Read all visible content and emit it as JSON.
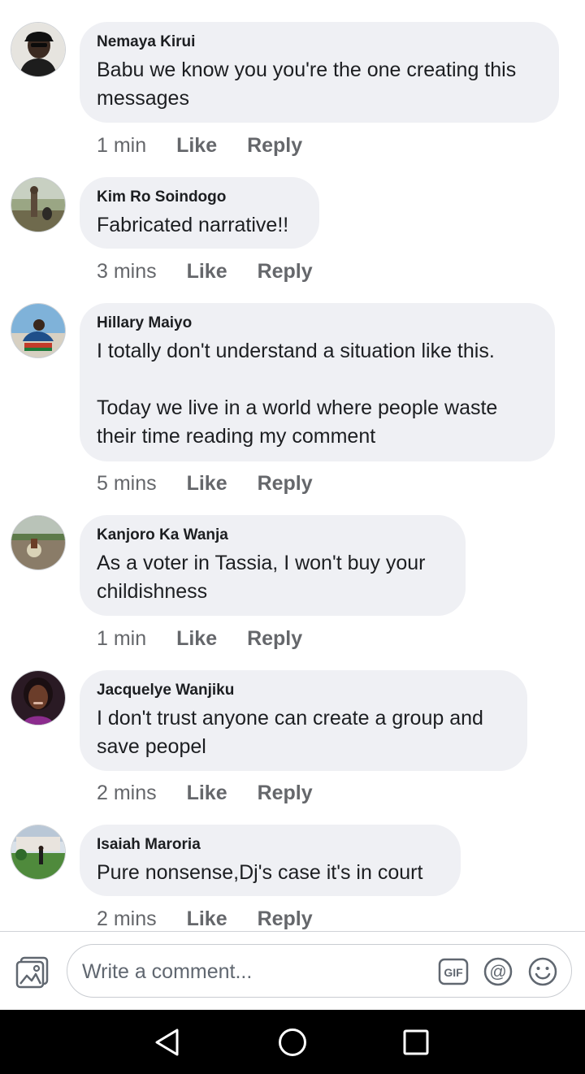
{
  "comments": [
    {
      "author": "Nemaya Kirui",
      "text": "Babu we know you you're the one creating this messages",
      "time": "1 min",
      "like": "Like",
      "reply": "Reply"
    },
    {
      "author": "Kim Ro Soindogo",
      "text": "Fabricated narrative!!",
      "time": "3 mins",
      "like": "Like",
      "reply": "Reply"
    },
    {
      "author": "Hillary Maiyo",
      "text": "I totally don't understand a situation like this.\n\nToday we live in a world where people waste their time reading my comment",
      "time": "5 mins",
      "like": "Like",
      "reply": "Reply"
    },
    {
      "author": "Kanjoro Ka Wanja",
      "text": "As a voter in Tassia, I won't buy your childishness",
      "time": "1 min",
      "like": "Like",
      "reply": "Reply"
    },
    {
      "author": "Jacquelye Wanjiku",
      "text": "I don't trust anyone can create a group and save peopel",
      "time": "2 mins",
      "like": "Like",
      "reply": "Reply"
    },
    {
      "author": "Isaiah Maroria",
      "text": "Pure nonsense,Dj's case it's in court",
      "time": "2 mins",
      "like": "Like",
      "reply": "Reply"
    }
  ],
  "composer": {
    "placeholder": "Write a comment...",
    "icons": [
      "photo-icon",
      "gif-icon",
      "mention-icon",
      "emoji-icon"
    ]
  },
  "navbar": {
    "icons": [
      "back-icon",
      "home-icon",
      "recents-icon"
    ]
  },
  "colors": {
    "bubble": "#eff0f4",
    "meta_text": "#65676b",
    "navbar": "#000000"
  }
}
